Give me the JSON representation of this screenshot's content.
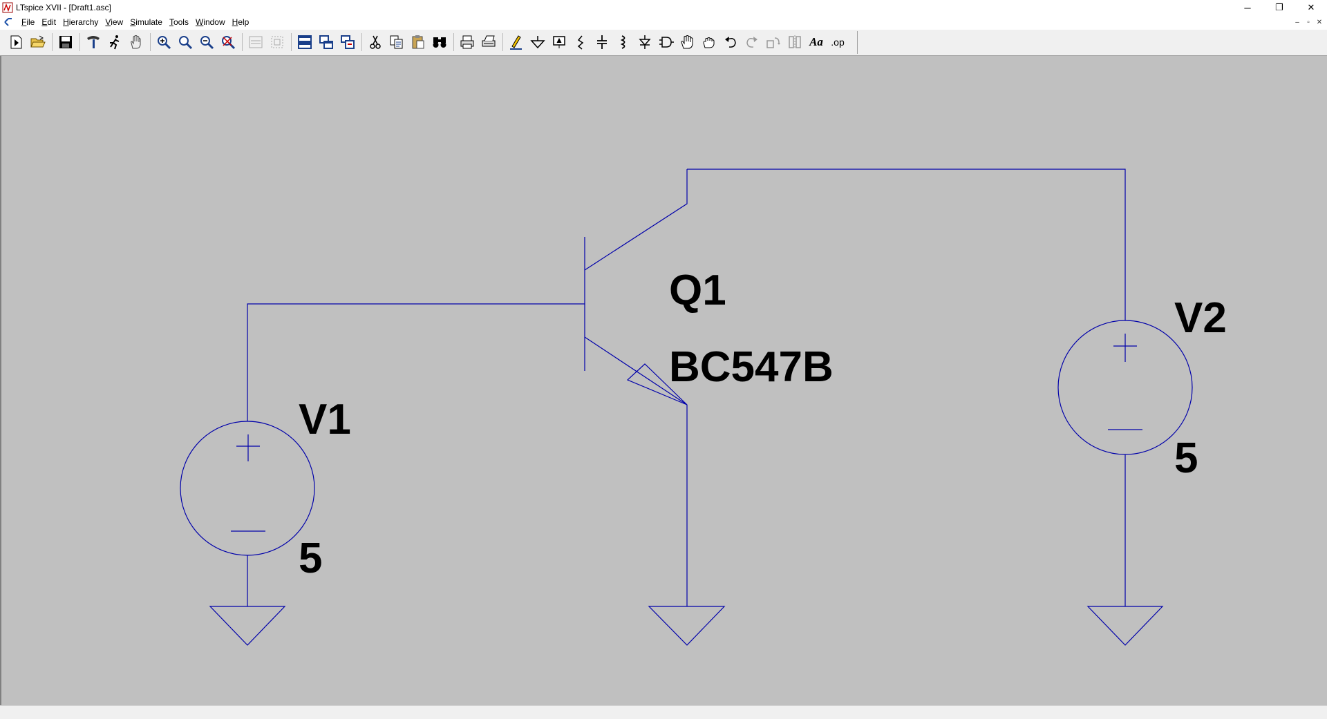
{
  "window": {
    "title": "LTspice XVII - [Draft1.asc]",
    "controls": {
      "minimize": "─",
      "restore": "❐",
      "close": "✕"
    }
  },
  "menubar": {
    "items": [
      "File",
      "Edit",
      "Hierarchy",
      "View",
      "Simulate",
      "Tools",
      "Window",
      "Help"
    ],
    "mdi_controls": {
      "minimize": "–",
      "restore": "▫",
      "close": "✕"
    }
  },
  "toolbar": {
    "text_glyph": "Aa",
    "spice_directive_glyph": ".op"
  },
  "schematic": {
    "wire_color": "#0000aa",
    "components": {
      "q1": {
        "name": "Q1",
        "value": "BC547B"
      },
      "v1": {
        "name": "V1",
        "value": "5"
      },
      "v2": {
        "name": "V2",
        "value": "5"
      }
    }
  },
  "colors": {
    "canvas_background": "#c0c0c0",
    "wire": "#0000aa",
    "label": "#000000"
  }
}
